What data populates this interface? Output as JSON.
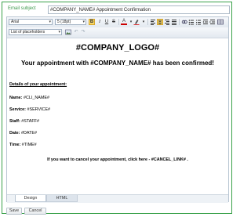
{
  "subject": {
    "label": "Email subject",
    "value": "#COMPANY_NAME# Appointment Confirmation"
  },
  "toolbar": {
    "font_family": "Arial",
    "font_size": "5 (18pt)",
    "placeholders": "List of placeholders",
    "buttons": [
      "B",
      "I",
      "U",
      "S",
      "A",
      "≡",
      "≡",
      "≡",
      "≡"
    ],
    "undo": "↶",
    "redo": "↷"
  },
  "content": {
    "logo": "#COMPANY_LOGO#",
    "heading": "Your appointment with #COMPANY_NAME# has been confirmed!",
    "details_heading": "Details of your appointment:",
    "fields": [
      {
        "label": "Name:",
        "value": "#CLI_NAME#"
      },
      {
        "label": "Service:",
        "value": "#SERVICE#"
      },
      {
        "label": "Staff:",
        "value": "#STAFF#"
      },
      {
        "label": "Date:",
        "value": "#DATE#"
      },
      {
        "label": "Time:",
        "value": "#TIME#"
      }
    ],
    "cancel_line": "If you want to cancel your appointment, click here -  #CANCEL_LINK# ."
  },
  "tabs": {
    "design": "Design",
    "html": "HTML"
  },
  "actions": {
    "save": "Save",
    "cancel": "Cancel"
  },
  "colors": {
    "accent": "#3aa14a",
    "active_button": "#f6d76a"
  }
}
